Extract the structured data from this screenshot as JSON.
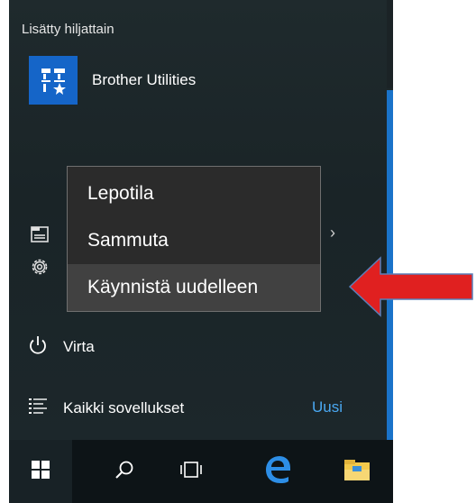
{
  "start_menu": {
    "recent_header": "Lisätty hiljattain",
    "recent_app": {
      "label": "Brother Utilities",
      "tile_color": "#1565c8",
      "icon": "brother-utilities-icon"
    },
    "side_rows": [
      {
        "name": "file-explorer",
        "icon": "folder-icon"
      },
      {
        "name": "settings",
        "icon": "gear-icon"
      }
    ],
    "power_label": "Virta",
    "all_apps_label": "Kaikki sovellukset",
    "new_badge": "Uusi",
    "accent_color": "#1a73c9"
  },
  "power_menu": {
    "items": [
      {
        "label": "Lepotila"
      },
      {
        "label": "Sammuta"
      },
      {
        "label": "Käynnistä uudelleen",
        "highlighted": true
      }
    ]
  },
  "taskbar": {
    "buttons": [
      {
        "name": "start",
        "icon": "windows-logo-icon"
      },
      {
        "name": "search",
        "icon": "search-icon"
      },
      {
        "name": "task-view",
        "icon": "task-view-icon"
      },
      {
        "name": "edge",
        "icon": "edge-browser-icon"
      },
      {
        "name": "file-explorer",
        "icon": "file-explorer-icon"
      }
    ]
  },
  "annotation": {
    "arrow_color": "#e02020",
    "icon": "red-arrow-icon"
  }
}
